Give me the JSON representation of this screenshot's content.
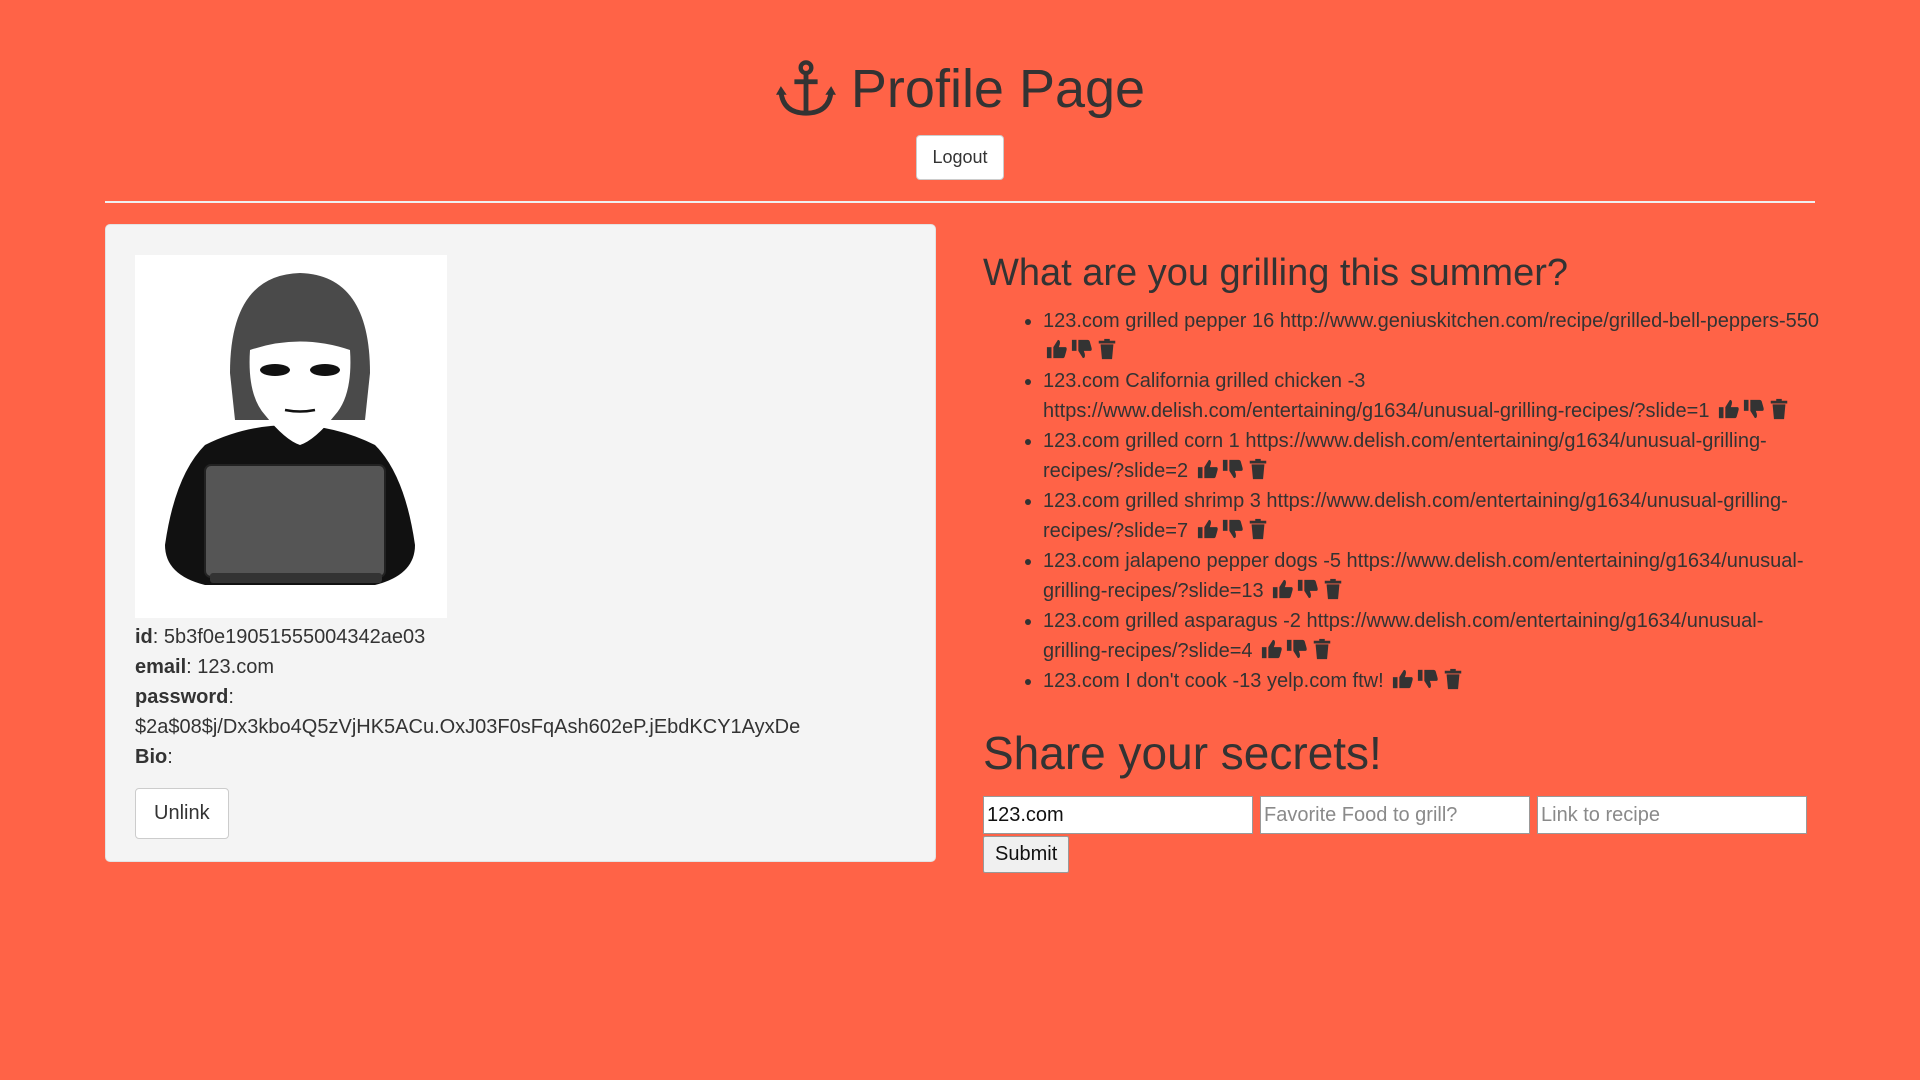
{
  "header": {
    "title": "Profile Page",
    "icon": "anchor-icon",
    "logout_label": "Logout"
  },
  "profile": {
    "avatar": "hooded-hacker-avatar",
    "id_label": "id",
    "id_value": "5b3f0e19051555004342ae03",
    "email_label": "email",
    "email_value": "123.com",
    "password_label": "password",
    "password_value": "$2a$08$j/Dx3kbo4Q5zVjHK5ACu.OxJ03F0sFqAsh602eP.jEbdKCY1AyxDe",
    "bio_label": "Bio",
    "bio_value": "",
    "unlink_label": "Unlink"
  },
  "feed": {
    "heading": "What are you grilling this summer?",
    "posts": [
      {
        "text": "123.com grilled pepper 16 http://www.geniuskitchen.com/recipe/grilled-bell-peppers-550"
      },
      {
        "text": "123.com California grilled chicken -3 https://www.delish.com/entertaining/g1634/unusual-grilling-recipes/?slide=1"
      },
      {
        "text": "123.com grilled corn 1 https://www.delish.com/entertaining/g1634/unusual-grilling-recipes/?slide=2"
      },
      {
        "text": "123.com grilled shrimp 3 https://www.delish.com/entertaining/g1634/unusual-grilling-recipes/?slide=7"
      },
      {
        "text": "123.com jalapeno pepper dogs -5 https://www.delish.com/entertaining/g1634/unusual-grilling-recipes/?slide=13"
      },
      {
        "text": "123.com grilled asparagus -2 https://www.delish.com/entertaining/g1634/unusual-grilling-recipes/?slide=4"
      },
      {
        "text": "123.com I don't cook -13 yelp.com ftw!"
      }
    ],
    "icons": [
      "thumbs-up-icon",
      "thumbs-down-icon",
      "trash-icon"
    ]
  },
  "share": {
    "heading": "Share your secrets!",
    "email_value": "123.com",
    "food_placeholder": "Favorite Food to grill?",
    "link_placeholder": "Link to recipe",
    "submit_label": "Submit"
  },
  "colors": {
    "background": "#ff6347",
    "card": "#f4f4f4",
    "text": "#333333"
  }
}
